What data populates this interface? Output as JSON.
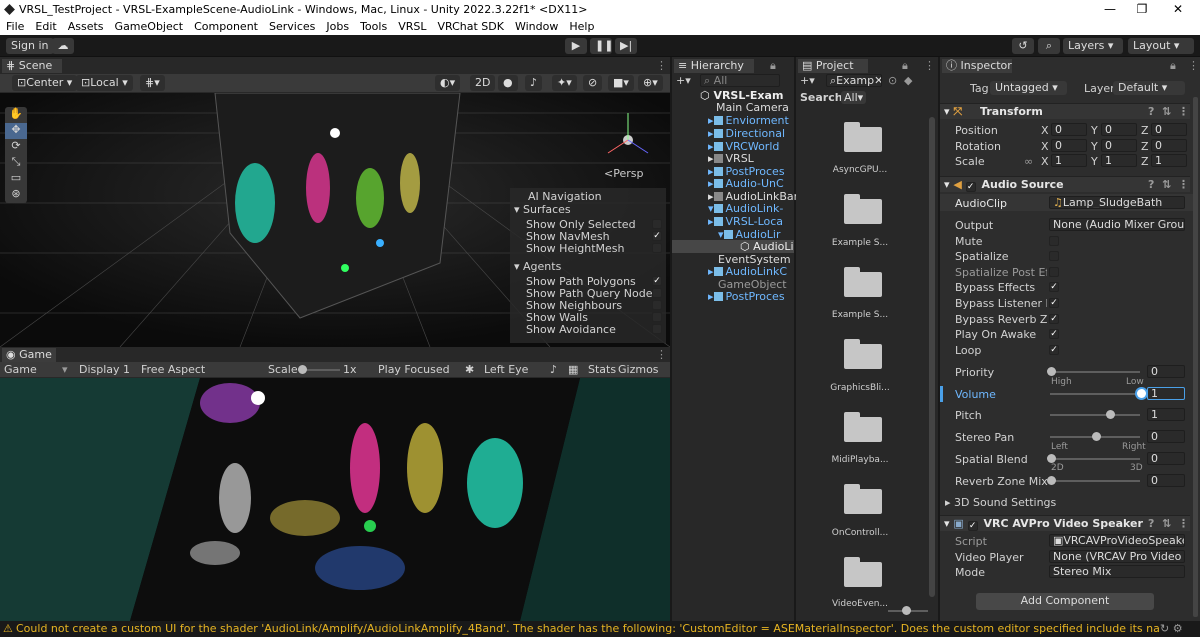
{
  "window": {
    "title": "VRSL_TestProject - VRSL-ExampleScene-AudioLink - Windows, Mac, Linux - Unity 2022.3.22f1* <DX11>"
  },
  "menu": [
    "File",
    "Edit",
    "Assets",
    "GameObject",
    "Component",
    "Services",
    "Jobs",
    "Tools",
    "VRSL",
    "VRChat SDK",
    "Window",
    "Help"
  ],
  "toolbar": {
    "signin": "Sign in",
    "layers": "Layers",
    "layout": "Layout"
  },
  "scene": {
    "tab": "Scene",
    "pivot": "Center",
    "space": "Local",
    "mode2d": "2D",
    "persp": "<Persp",
    "nav": {
      "title": "AI Navigation",
      "surfaces": "Surfaces",
      "items1": [
        {
          "label": "Show Only Selected",
          "checked": ""
        },
        {
          "label": "Show NavMesh",
          "checked": "✓"
        },
        {
          "label": "Show HeightMesh",
          "checked": ""
        }
      ],
      "agents": "Agents",
      "items2": [
        {
          "label": "Show Path Polygons",
          "checked": "✓"
        },
        {
          "label": "Show Path Query Nodes",
          "checked": ""
        },
        {
          "label": "Show Neighbours",
          "checked": ""
        },
        {
          "label": "Show Walls",
          "checked": ""
        },
        {
          "label": "Show Avoidance",
          "checked": ""
        }
      ]
    }
  },
  "game": {
    "tab": "Game",
    "mode": "Game",
    "display": "Display 1",
    "aspect": "Free Aspect",
    "scale": "Scale",
    "scale_val": "1x",
    "play": "Play Focused",
    "eye": "Left Eye",
    "stats": "Stats",
    "gizmos": "Gizmos"
  },
  "hierarchy": {
    "tab": "Hierarchy",
    "search": "All",
    "items": [
      {
        "label": "VRSL-Exam",
        "style": "root"
      },
      {
        "label": "Main Camera",
        "style": "white"
      },
      {
        "label": "Enviorment",
        "style": "blue"
      },
      {
        "label": "Directional",
        "style": "blue"
      },
      {
        "label": "VRCWorld",
        "style": "blue"
      },
      {
        "label": "VRSL",
        "style": "white"
      },
      {
        "label": "PostProces",
        "style": "blue"
      },
      {
        "label": "Audio-UnC",
        "style": "blue"
      },
      {
        "label": "AudioLinkBar",
        "style": "white"
      },
      {
        "label": "AudioLink-",
        "style": "blue"
      },
      {
        "label": "VRSL-Loca",
        "style": "blue"
      },
      {
        "label": "AudioLir",
        "style": "blue"
      },
      {
        "label": "AudioLin",
        "style": "white"
      },
      {
        "label": "EventSystem",
        "style": "white"
      },
      {
        "label": "AudioLinkC",
        "style": "blue"
      },
      {
        "label": "GameObject",
        "style": "gray"
      },
      {
        "label": "PostProces",
        "style": "blue"
      }
    ]
  },
  "project": {
    "tab": "Project",
    "search": "Examp",
    "searchlabel": "Search:",
    "filter": "All",
    "folders": [
      "AsyncGPU...",
      "Example S...",
      "Example S...",
      "GraphicsBli...",
      "MidiPlayba...",
      "OnControll...",
      "VideoEven..."
    ]
  },
  "inspector": {
    "tab": "Inspector",
    "tag_label": "Tag",
    "tag": "Untagged",
    "layer_label": "Layer",
    "layer": "Default",
    "transform": {
      "title": "Transform",
      "rows": [
        {
          "label": "Position",
          "x": "0",
          "y": "0",
          "z": "0"
        },
        {
          "label": "Rotation",
          "x": "0",
          "y": "0",
          "z": "0"
        },
        {
          "label": "Scale",
          "x": "1",
          "y": "1",
          "z": "1"
        }
      ]
    },
    "audio": {
      "title": "Audio Source",
      "clip_label": "AudioClip",
      "clip": "Lamp_SludgeBath",
      "output_label": "Output",
      "output": "None (Audio Mixer Group)",
      "checks": [
        {
          "label": "Mute",
          "checked": ""
        },
        {
          "label": "Spatialize",
          "checked": ""
        },
        {
          "label": "Spatialize Post Effec",
          "checked": ""
        },
        {
          "label": "Bypass Effects",
          "checked": "✓"
        },
        {
          "label": "Bypass Listener Effe",
          "checked": "✓"
        },
        {
          "label": "Bypass Reverb Zone",
          "checked": "✓"
        },
        {
          "label": "Play On Awake",
          "checked": "✓"
        },
        {
          "label": "Loop",
          "checked": "✓"
        }
      ],
      "priority_label": "Priority",
      "priority": "0",
      "high": "High",
      "low": "Low",
      "volume_label": "Volume",
      "volume": "1",
      "pitch_label": "Pitch",
      "pitch": "1",
      "pan_label": "Stereo Pan",
      "pan": "0",
      "left": "Left",
      "right": "Right",
      "blend_label": "Spatial Blend",
      "blend": "0",
      "d2": "2D",
      "d3": "3D",
      "reverb_label": "Reverb Zone Mix",
      "reverb": "0",
      "sound3d": "3D Sound Settings",
      "priority_level": 0,
      "volume_level": 1,
      "pitch_level": 0.66,
      "pan_level": 0.5,
      "blend_level": 0,
      "reverb_level": 0
    },
    "vrc": {
      "title": "VRC AVPro Video Speaker",
      "script_label": "Script",
      "script": "VRCAVProVideoSpeaker",
      "player_label": "Video Player",
      "player": "None (VRCAV Pro Video P",
      "mode_label": "Mode",
      "mode": "Stereo Mix"
    },
    "add": "Add Component"
  },
  "status": "Could not create a custom UI for the shader 'AudioLink/Amplify/AudioLinkAmplify_4Band'. The shader has the following: 'CustomEditor = ASEMaterialInspector'. Does the custom editor specified include its namespace? And does the class either"
}
